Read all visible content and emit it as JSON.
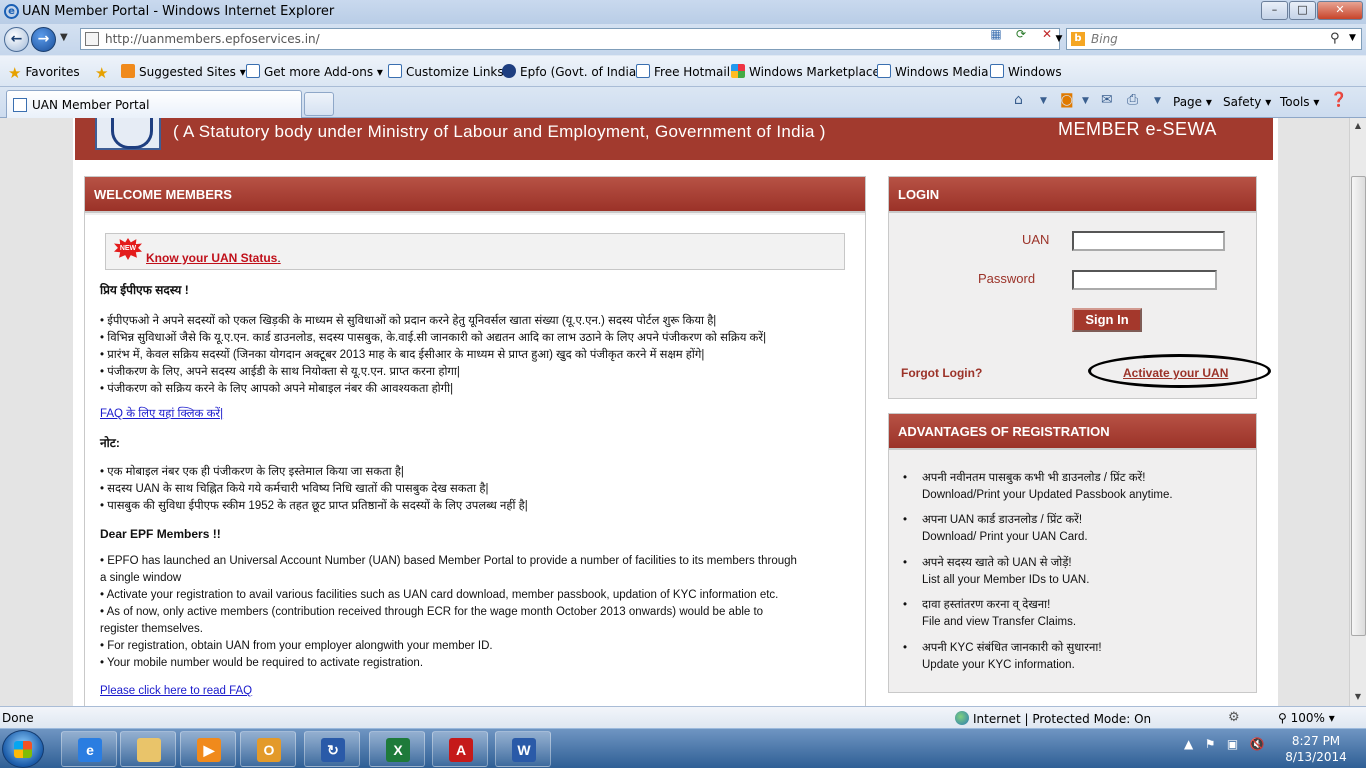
{
  "window": {
    "title": "UAN Member Portal - Windows Internet Explorer",
    "min_label": "–",
    "max_label": "□",
    "close_label": "✕"
  },
  "address": {
    "url": "http://uanmembers.epfoservices.in/",
    "search_placeholder": "Bing"
  },
  "favorites": {
    "items": [
      "Favorites",
      "Suggested Sites ▾",
      "Get more Add-ons ▾",
      "Customize Links",
      "Epfo (Govt. of India)",
      "Free Hotmail",
      "Windows Marketplace",
      "Windows Media",
      "Windows"
    ]
  },
  "tabs": {
    "active_label": "UAN Member Portal"
  },
  "commandbar": {
    "page": "Page ▾",
    "safety": "Safety ▾",
    "tools": "Tools ▾"
  },
  "banner": {
    "tagline": "( A Statutory body under Ministry of Labour and Employment, Government of India )",
    "member_eseva": "MEMBER  e-SEWA"
  },
  "welcome": {
    "header": "WELCOME MEMBERS",
    "new_badge": "NEW",
    "status_link": "Know your UAN Status",
    "status_period": ".",
    "hindi_greeting": "प्रिय ईपीएफ सदस्य !",
    "hindi_points": [
      "•  ईपीएफओ ने अपने सदस्यों को एकल खिड़की के माध्यम से सुविधाओं को प्रदान करने हेतु यूनिवर्सल खाता संख्या (यू.ए.एन.) सदस्य पोर्टल शुरू किया है|",
      "•  विभिन्न सुविधाओं जैसे कि यू.ए.एन. कार्ड डाउनलोड, सदस्य पासबुक, के.वाई.सी जानकारी को अद्यतन आदि का लाभ उठाने के लिए अपने पंजीकरण को सक्रिय करें|",
      "•  प्रारंभ में, केवल सक्रिय सदस्यों (जिनका योगदान अक्टूबर 2013 माह के बाद ईसीआर के माध्यम से प्राप्त हुआ) खुद को पंजीकृत करने में सक्षम होंगे|",
      "•  पंजीकरण के लिए, अपने सदस्य आईडी के साथ नियोक्ता से यू.ए.एन. प्राप्त करना होगा|",
      "•  पंजीकरण को सक्रिय करने के लिए आपको अपने मोबाइल नंबर की आवश्यकता होगी|"
    ],
    "faq_hindi_link": "FAQ के लिए यहां क्लिक करें|",
    "note_label": "नोट:",
    "note_points": [
      "•  एक मोबाइल नंबर एक ही पंजीकरण के लिए इस्तेमाल किया जा सकता है|",
      "•  सदस्य UAN के साथ चिह्नित किये गये कर्मचारी भविष्य निधि खातों की पासबुक देख सकता है|",
      "•  पासबुक की सुविधा ईपीएफ स्कीम 1952 के तहत छूट प्राप्त प्रतिष्ठानों के सदस्यों के लिए उपलब्ध नहीं है|"
    ],
    "english_greeting": "Dear EPF Members !!",
    "english_lines": [
      "•  EPFO has launched an Universal Account Number (UAN) based Member Portal to provide a number of facilities to its members through",
      "a single window",
      "•  Activate your registration to avail various facilities such as UAN card download, member passbook, updation of KYC information etc.",
      "•  As of now, only active members (contribution received through ECR for the wage month October 2013 onwards) would be able to",
      "register themselves.",
      "•  For registration, obtain UAN from your employer alongwith your member ID.",
      "•  Your mobile number would be required to activate registration."
    ],
    "faq_english_link": "Please click here to read FAQ"
  },
  "login": {
    "header": "LOGIN",
    "uan_label": "UAN",
    "password_label": "Password",
    "uan_value": "",
    "password_value": "",
    "signin_label": "Sign In",
    "forgot_label": "Forgot Login?",
    "activate_label": "Activate your UAN"
  },
  "advantages": {
    "header": "ADVANTAGES OF REGISTRATION",
    "items": [
      {
        "hindi": "अपनी नवीनतम पासबुक कभी भी डाउनलोड / प्रिंट करें!",
        "english": "Download/Print your Updated Passbook anytime."
      },
      {
        "hindi": "अपना UAN कार्ड डाउनलोड / प्रिंट करें!",
        "english": "Download/ Print your UAN Card."
      },
      {
        "hindi": "अपने सदस्य खाते को UAN से जोड़ें!",
        "english": "List all your Member IDs to UAN."
      },
      {
        "hindi": "दावा हस्तांतरण करना व् देखना!",
        "english": "File and view Transfer Claims."
      },
      {
        "hindi": "अपनी KYC संबंधित जानकारी को सुधारना!",
        "english": "Update your KYC information."
      }
    ],
    "bullet": "•"
  },
  "statusbar": {
    "done": "Done",
    "zone": "Internet | Protected Mode: On",
    "zoom": "100% ▾"
  },
  "taskbar": {
    "apps": [
      "ie-icon",
      "explorer-icon",
      "media-player-icon",
      "outlook-icon",
      "remote-icon",
      "excel-icon",
      "acrobat-icon",
      "word-icon"
    ],
    "app_letters": [
      "e",
      "",
      "▶",
      "O",
      "↻",
      "X",
      "A",
      "W"
    ],
    "time": "8:27 PM",
    "date": "8/13/2014"
  },
  "colors": {
    "brand_red": "#a23a2e",
    "link_blue": "#1a1acc",
    "status_red": "#c0101a"
  }
}
